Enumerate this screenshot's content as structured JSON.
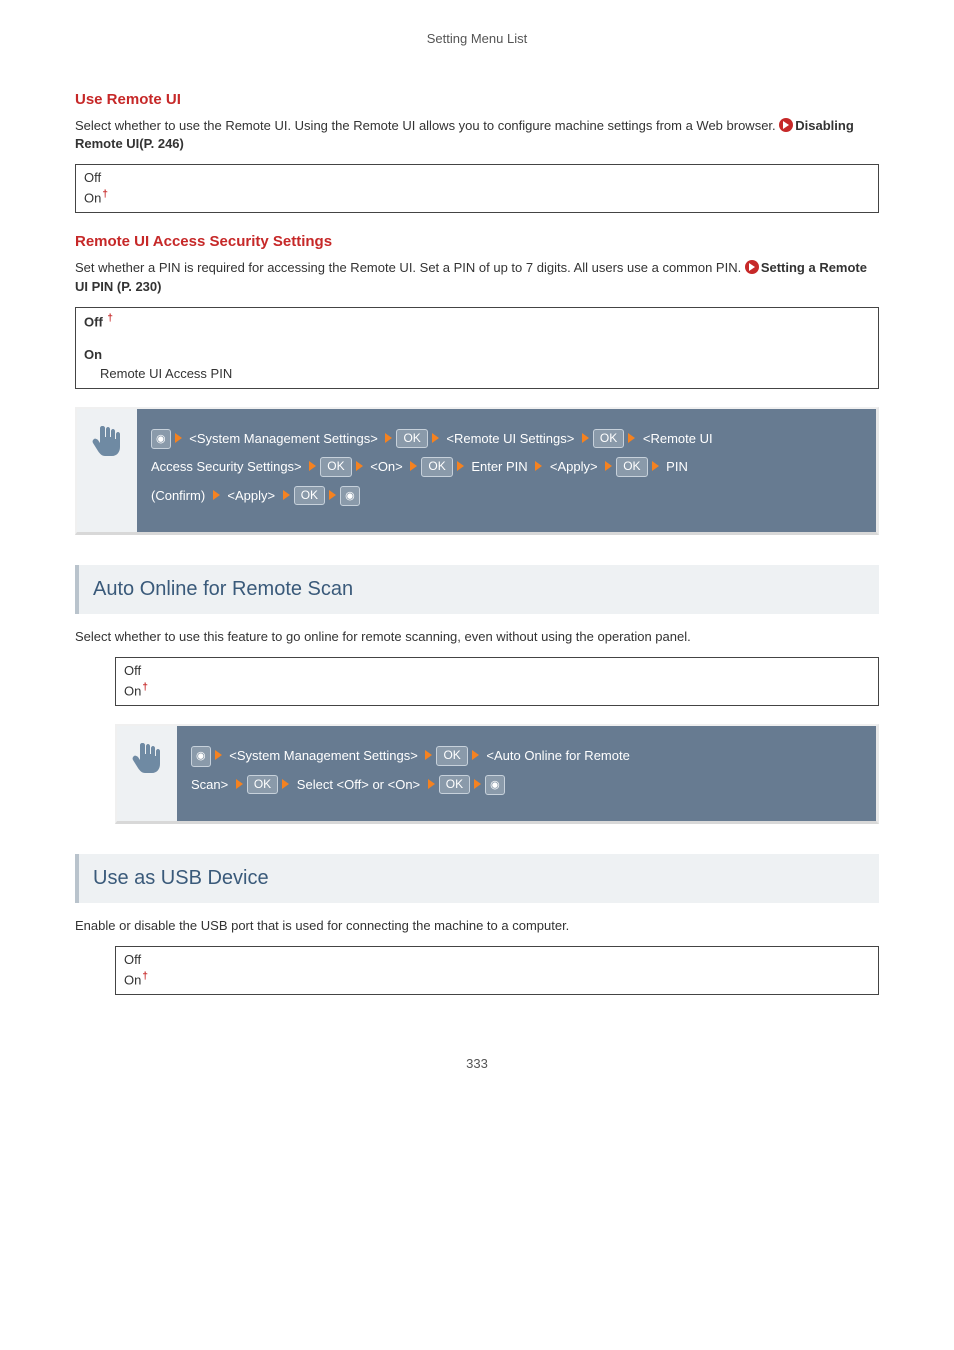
{
  "header": "Setting Menu List",
  "s1": {
    "heading": "Use Remote UI",
    "desc": "Select whether to use the Remote UI. Using the Remote UI allows you to configure machine settings from a Web browser. ",
    "link": "Disabling Remote UI(P. 246)",
    "opts": {
      "off": "Off",
      "on": "On"
    }
  },
  "s2": {
    "heading": "Remote UI Access Security Settings",
    "desc": "Set whether a PIN is required for accessing the Remote UI. Set a PIN of up to 7 digits. All users use a common PIN. ",
    "link": "Setting a Remote UI PIN (P. 230)",
    "opts": {
      "off": "Off",
      "on": "On",
      "sub": "Remote UI Access PIN"
    },
    "instr": {
      "p1a": " <System Management Settings> ",
      "p1b": " <Remote UI Settings> ",
      "p1c": " <Remote UI ",
      "p2a": "Access Security Settings> ",
      "p2b": " <On> ",
      "p2c": " Enter PIN ",
      "p2d": " <Apply> ",
      "p2e": " PIN ",
      "p3a": "(Confirm) ",
      "p3b": " <Apply> "
    }
  },
  "s3": {
    "heading": "Auto Online for Remote Scan",
    "desc": "Select whether to use this feature to go online for remote scanning, even without using the operation panel.",
    "opts": {
      "off": "Off",
      "on": "On"
    },
    "instr": {
      "p1a": " <System Management Settings> ",
      "p1b": " <Auto Online for Remote ",
      "p2a": "Scan> ",
      "p2b": " Select <Off> or <On> "
    }
  },
  "s4": {
    "heading": "Use as USB Device",
    "desc": "Enable or disable the USB port that is used for connecting the machine to a computer.",
    "opts": {
      "off": "Off",
      "on": "On"
    }
  },
  "keys": {
    "ok": "OK"
  },
  "pageNumber": "333"
}
